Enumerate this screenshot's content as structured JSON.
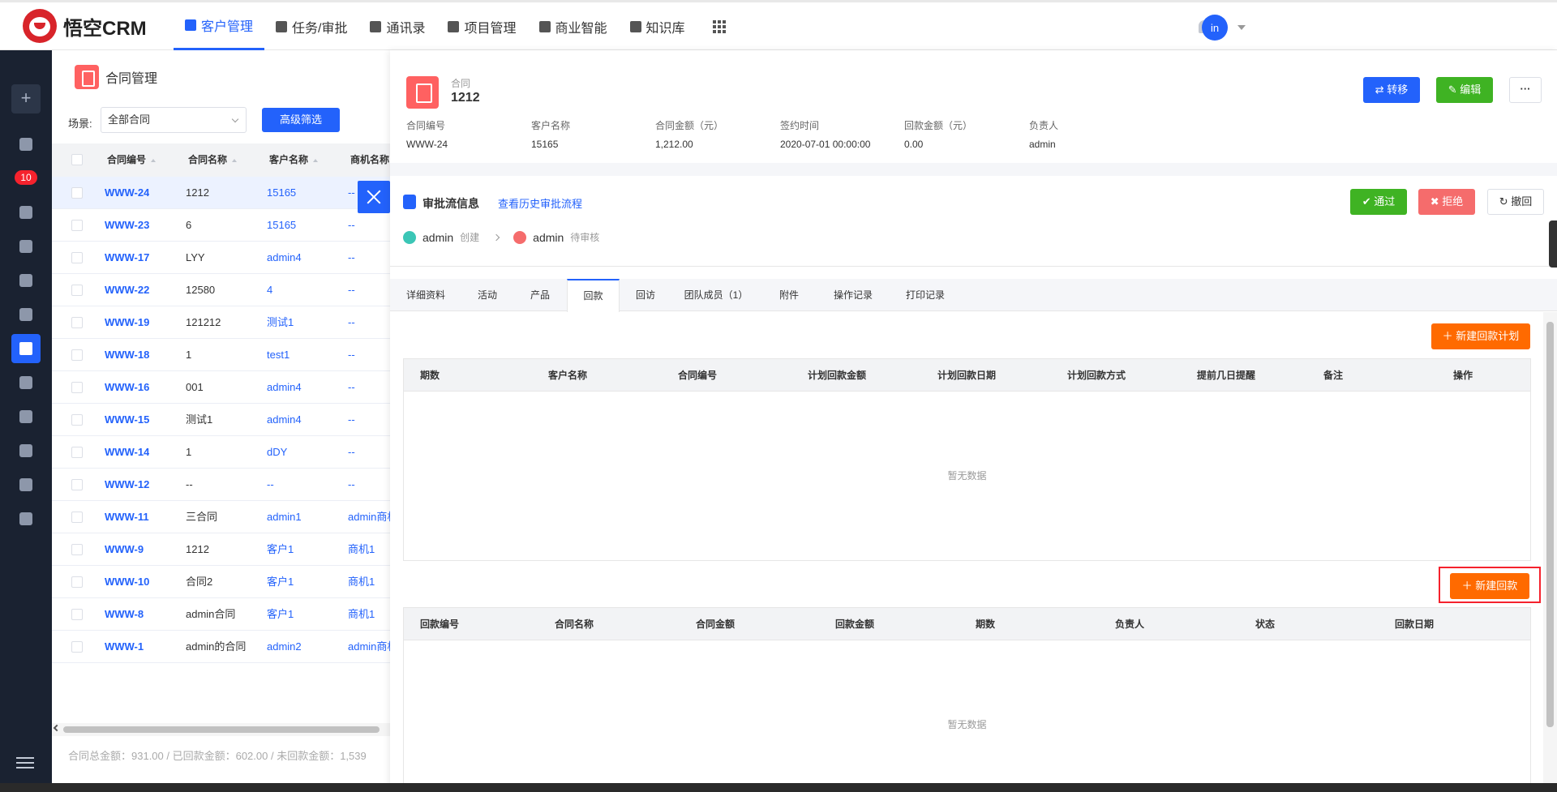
{
  "app": {
    "logo_text": "悟空CRM",
    "avatar_text": "in"
  },
  "nav": {
    "items": [
      {
        "label": "客户管理",
        "icon": "customer-icon",
        "active": true
      },
      {
        "label": "任务/审批",
        "icon": "task-icon"
      },
      {
        "label": "通讯录",
        "icon": "contacts-icon"
      },
      {
        "label": "项目管理",
        "icon": "project-icon"
      },
      {
        "label": "商业智能",
        "icon": "bi-icon"
      },
      {
        "label": "知识库",
        "icon": "knowledge-icon"
      }
    ]
  },
  "sidebar": {
    "badge": "10"
  },
  "list": {
    "title": "合同管理",
    "scene_label": "场景:",
    "scene_value": "全部合同",
    "filter_button": "高级筛选",
    "columns": [
      "合同编号",
      "合同名称",
      "客户名称",
      "商机名称"
    ],
    "rows": [
      [
        "WWW-24",
        "1212",
        "15165",
        "--"
      ],
      [
        "WWW-23",
        "6",
        "15165",
        "--"
      ],
      [
        "WWW-17",
        "LYY",
        "admin4",
        "--"
      ],
      [
        "WWW-22",
        "12580",
        "4",
        "--"
      ],
      [
        "WWW-19",
        "121212",
        "测试1",
        "--"
      ],
      [
        "WWW-18",
        "1",
        "test1",
        "--"
      ],
      [
        "WWW-16",
        "001",
        "admin4",
        "--"
      ],
      [
        "WWW-15",
        "测试1",
        "admin4",
        "--"
      ],
      [
        "WWW-14",
        "1",
        "dDY",
        "--"
      ],
      [
        "WWW-12",
        "--",
        "--",
        "--"
      ],
      [
        "WWW-11",
        "三合同",
        "admin1",
        "admin商机"
      ],
      [
        "WWW-9",
        "1212",
        "客户1",
        "商机1"
      ],
      [
        "WWW-10",
        "合同2",
        "客户1",
        "商机1"
      ],
      [
        "WWW-8",
        "admin合同",
        "客户1",
        "商机1"
      ],
      [
        "WWW-1",
        "admin的合同",
        "admin2",
        "admin商机"
      ]
    ],
    "summary": "合同总金额：931.00 / 已回款金额：602.00 / 未回款金额：1,539"
  },
  "detail": {
    "type_label": "合同",
    "title": "1212",
    "buttons": {
      "transfer": "转移",
      "edit": "编辑",
      "more": "···"
    },
    "meta": [
      {
        "label": "合同编号",
        "value": "WWW-24"
      },
      {
        "label": "客户名称",
        "value": "15165"
      },
      {
        "label": "合同金额（元）",
        "value": "1,212.00"
      },
      {
        "label": "签约时间",
        "value": "2020-07-01 00:00:00"
      },
      {
        "label": "回款金额（元）",
        "value": "0.00"
      },
      {
        "label": "负责人",
        "value": "admin"
      }
    ],
    "approval": {
      "title": "审批流信息",
      "history_link": "查看历史审批流程",
      "pass": "通过",
      "reject": "拒绝",
      "revoke": "撤回",
      "flow": [
        {
          "user": "admin",
          "status": "创建"
        },
        {
          "user": "admin",
          "status": "待审核"
        }
      ]
    },
    "tabs": [
      "详细资料",
      "活动",
      "产品",
      "回款",
      "回访",
      "团队成员（1）",
      "附件",
      "操作记录",
      "打印记录"
    ],
    "active_tab": "回款",
    "plan_button": "新建回款计划",
    "plan_columns": [
      "期数",
      "客户名称",
      "合同编号",
      "计划回款金额",
      "计划回款日期",
      "计划回款方式",
      "提前几日提醒",
      "备注",
      "操作"
    ],
    "new_button": "新建回款",
    "receivable_columns": [
      "回款编号",
      "合同名称",
      "合同金额",
      "回款金额",
      "期数",
      "负责人",
      "状态",
      "回款日期"
    ],
    "empty_text": "暂无数据"
  },
  "colors": {
    "primary": "#2362fb",
    "success": "#3fb323",
    "danger": "#f56c6c",
    "warning": "#ff6a00"
  }
}
